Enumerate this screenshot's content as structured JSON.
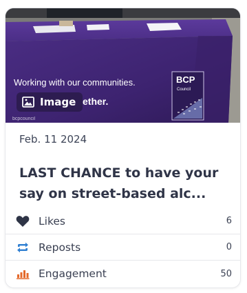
{
  "post": {
    "media_badge": "Image",
    "media_badge_icon": "image-icon",
    "photo_banner_text": "Working with our communities.",
    "photo_logo_text": "BCP",
    "photo_logo_sub": "Council",
    "date": "Feb. 11 2024",
    "title": "LAST CHANCE to have your say on street-based alc..."
  },
  "stats": [
    {
      "label": "Likes",
      "value": "6",
      "icon": "heart-icon",
      "color": "#2e3446"
    },
    {
      "label": "Reposts",
      "value": "0",
      "icon": "repost-icon",
      "color": "#2f7fd1"
    },
    {
      "label": "Engagement",
      "value": "50",
      "icon": "bar-chart-icon",
      "color": "#e4692a"
    }
  ]
}
